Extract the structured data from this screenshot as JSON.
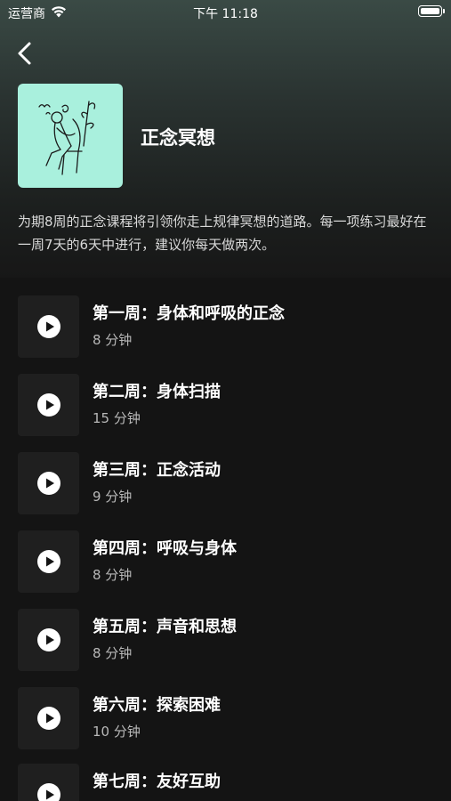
{
  "status_bar": {
    "carrier": "运营商",
    "time": "下午 11:18",
    "wifi_icon": "wifi-icon",
    "battery_icon": "battery-icon"
  },
  "header": {
    "back_icon": "chevron-left-icon"
  },
  "course": {
    "title": "正念冥想",
    "cover_color": "#a9f0dd",
    "description": "为期8周的正念课程将引领你走上规律冥想的道路。每一项练习最好在一周7天的6天中进行，建议你每天做两次。"
  },
  "lessons": [
    {
      "title": "第一周：身体和呼吸的正念",
      "duration": "8 分钟"
    },
    {
      "title": "第二周：身体扫描",
      "duration": "15 分钟"
    },
    {
      "title": "第三周：正念活动",
      "duration": "9 分钟"
    },
    {
      "title": "第四周：呼吸与身体",
      "duration": "8 分钟"
    },
    {
      "title": "第五周：声音和思想",
      "duration": "8 分钟"
    },
    {
      "title": "第六周：探索困难",
      "duration": "10 分钟"
    },
    {
      "title": "第七周：友好互助",
      "duration": ""
    }
  ],
  "colors": {
    "background": "#141414",
    "accent": "#a9f0dd",
    "secondary_text": "#b8b8b8"
  }
}
